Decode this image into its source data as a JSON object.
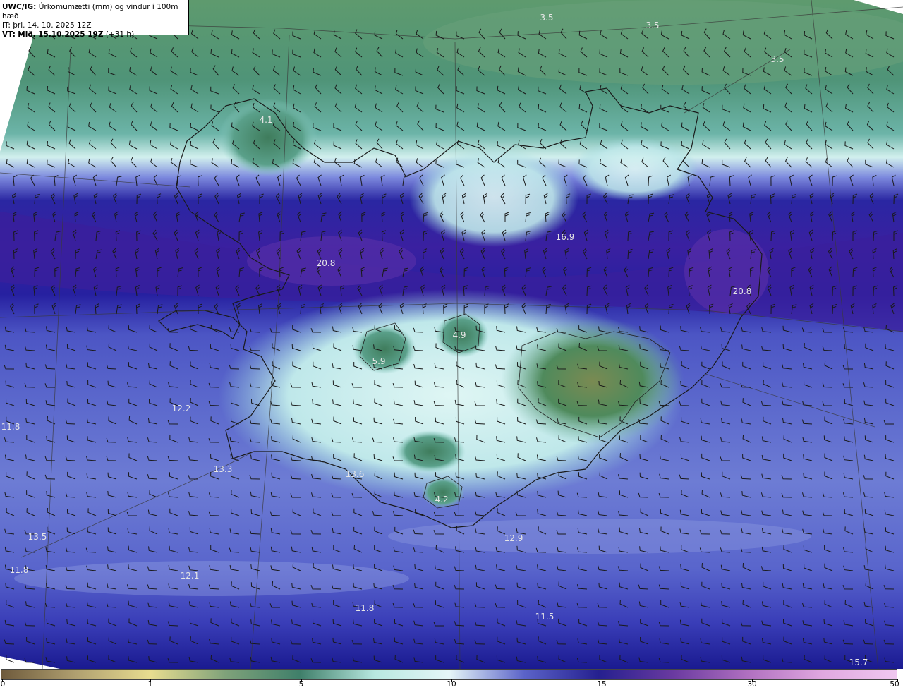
{
  "info": {
    "model": "UWC/IG:",
    "title": "Úrkomumætti (mm) og vindur í 100m hæð",
    "it_label": "IT:",
    "it_value": "þri. 14. 10. 2025 12Z",
    "vt_label": "VT:",
    "vt_value": "Mið. 15.10.2025 19Z",
    "lead": "(+31 h)"
  },
  "map_values": [
    {
      "label": "3.5"
    },
    {
      "label": "3.5"
    },
    {
      "label": "3.5"
    },
    {
      "label": "4.1"
    },
    {
      "label": "16.9"
    },
    {
      "label": "20.8"
    },
    {
      "label": "20.8"
    },
    {
      "label": "4.9"
    },
    {
      "label": "5.9"
    },
    {
      "label": "12.2"
    },
    {
      "label": "11.8"
    },
    {
      "label": "13.3"
    },
    {
      "label": "13.6"
    },
    {
      "label": "4.2"
    },
    {
      "label": "12.9"
    },
    {
      "label": "13.5"
    },
    {
      "label": "11.8"
    },
    {
      "label": "12.1"
    },
    {
      "label": "11.8"
    },
    {
      "label": "11.5"
    },
    {
      "label": "15.7"
    }
  ],
  "legend": {
    "ticks": [
      "0",
      "1",
      "5",
      "10",
      "15",
      "30",
      "50"
    ],
    "colors": [
      "#6e5a3c",
      "#b0a070",
      "#e8dd90",
      "#7fa27a",
      "#3f7f6a",
      "#b8e8e0",
      "#e6f6f8",
      "#5b63c9",
      "#25208f",
      "#6a3aa0",
      "#b070c0",
      "#e0a8e0",
      "#f0c8f0"
    ]
  },
  "colors": {
    "dry_brown": "#8a7a40",
    "low_green": "#3e7c58",
    "mid_teal": "#5aa098",
    "light_cyan": "#d8f4f2",
    "blue": "#5d6bd0",
    "navy": "#1e1b98",
    "purple": "#5b2ea6"
  }
}
